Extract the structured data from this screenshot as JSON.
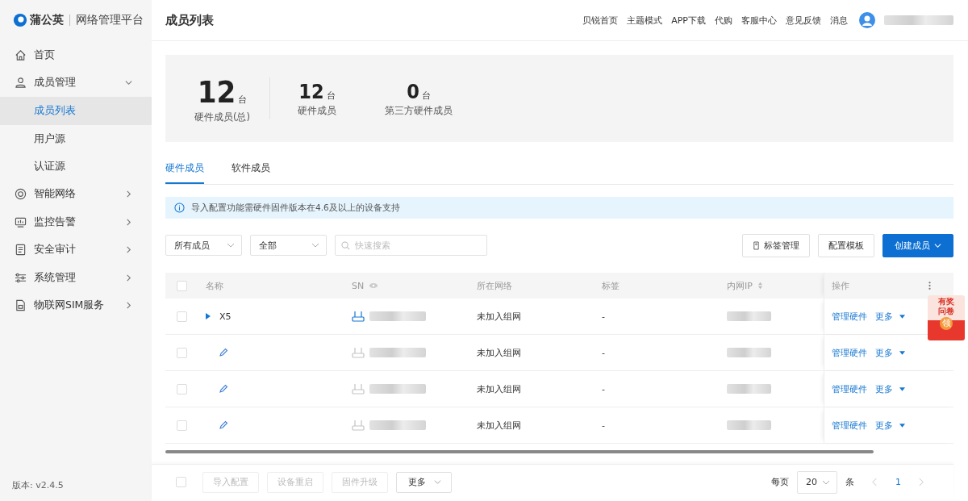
{
  "brand": {
    "name": "蒲公英",
    "product": "网络管理平台"
  },
  "sidebar": {
    "items": [
      {
        "label": "首页",
        "selected": false
      },
      {
        "label": "成员管理",
        "expanded": true,
        "selected": false,
        "children": [
          {
            "label": "成员列表",
            "selected": true
          },
          {
            "label": "用户源",
            "selected": false
          },
          {
            "label": "认证源",
            "selected": false
          }
        ]
      },
      {
        "label": "智能网络",
        "expanded": false,
        "selected": false
      },
      {
        "label": "监控告警",
        "expanded": false,
        "selected": false
      },
      {
        "label": "安全审计",
        "expanded": false,
        "selected": false
      },
      {
        "label": "系统管理",
        "expanded": false,
        "selected": false
      },
      {
        "label": "物联网SIM服务",
        "expanded": false,
        "selected": false
      }
    ],
    "version": "版本: v2.4.5"
  },
  "header": {
    "title": "成员列表",
    "links": [
      "贝锐首页",
      "主题模式",
      "APP下载",
      "代购",
      "客服中心",
      "意见反馈",
      "消息"
    ]
  },
  "stats": [
    {
      "value": "12",
      "unit": "台",
      "label": "硬件成员(总)",
      "kind": "main"
    },
    {
      "value": "12",
      "unit": "台",
      "label": "硬件成员",
      "kind": "sub"
    },
    {
      "value": "0",
      "unit": "台",
      "label": "第三方硬件成员",
      "kind": "sub"
    }
  ],
  "tabs": [
    {
      "label": "硬件成员",
      "selected": true
    },
    {
      "label": "软件成员",
      "selected": false
    }
  ],
  "notice": "导入配置功能需硬件固件版本在4.6及以上的设备支持",
  "filters": {
    "member_select": "所有成员",
    "status_select": "全部",
    "search": {
      "placeholder": "快速搜索"
    }
  },
  "actions": {
    "tag_button": "标签管理",
    "template_button": "配置模板",
    "create_button": "创建成员"
  },
  "table": {
    "all_checked": false,
    "columns": [
      "名称",
      "SN",
      "所在网络",
      "标签",
      "内网IP",
      "操作"
    ],
    "rows": [
      {
        "kind": "group",
        "name": "X5",
        "sn_active": true,
        "network": "未加入组网",
        "tag": "-",
        "manage": "管理硬件",
        "more": "更多",
        "checked": false
      },
      {
        "kind": "member",
        "sn_active": false,
        "network": "未加入组网",
        "tag": "-",
        "manage": "管理硬件",
        "more": "更多",
        "checked": false
      },
      {
        "kind": "member",
        "sn_active": false,
        "network": "未加入组网",
        "tag": "-",
        "manage": "管理硬件",
        "more": "更多",
        "checked": false
      },
      {
        "kind": "member",
        "sn_active": false,
        "network": "未加入组网",
        "tag": "-",
        "manage": "管理硬件",
        "more": "更多",
        "checked": false
      }
    ]
  },
  "footer": {
    "checked": false,
    "buttons": [
      "导入配置",
      "设备重启",
      "固件升级"
    ],
    "more": "更多",
    "per_page_label": "每页",
    "per_page": "20",
    "unit": "条",
    "page": "1"
  },
  "promo": {
    "title": "有奖问卷",
    "claim": "领"
  }
}
